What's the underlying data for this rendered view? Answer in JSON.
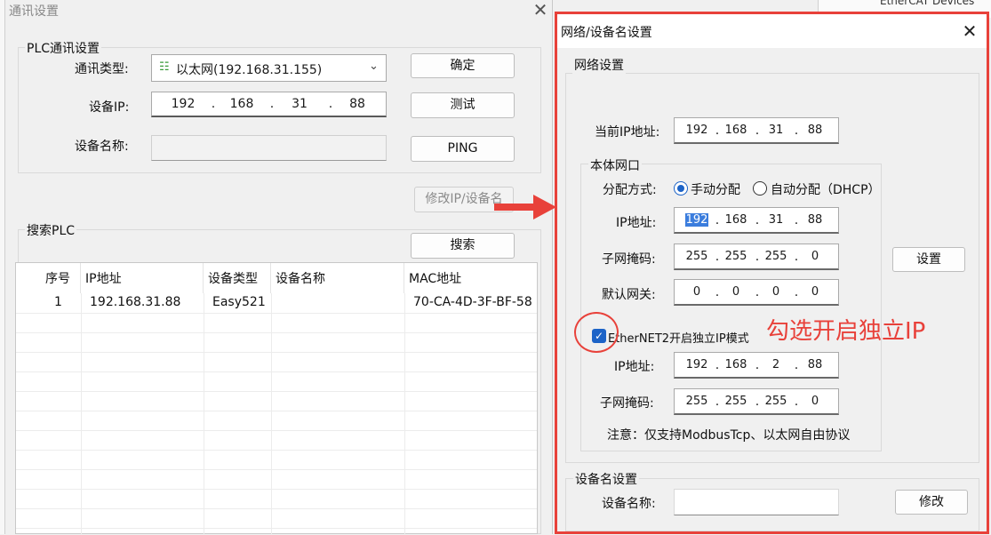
{
  "background": {
    "tree_item": "EtherCAT Devices"
  },
  "comm_dialog": {
    "title": "通讯设置",
    "plc_group_label": "PLC通讯设置",
    "comm_type_label": "通讯类型:",
    "comm_type_value": "以太网(192.168.31.155)",
    "device_ip_label": "设备IP:",
    "device_ip": [
      "192",
      "168",
      "31",
      "88"
    ],
    "device_name_label": "设备名称:",
    "confirm_button": "确定",
    "test_button": "测试",
    "ping_button": "PING",
    "modify_ip_button": "修改IP/设备名",
    "search_group_label": "搜索PLC",
    "search_button": "搜索",
    "table": {
      "columns": [
        "序号",
        "IP地址",
        "设备类型",
        "设备名称",
        "MAC地址"
      ],
      "rows": [
        {
          "no": "1",
          "ip": "192.168.31.88",
          "type": "Easy521",
          "name": "",
          "mac": "70-CA-4D-3F-BF-58"
        }
      ]
    }
  },
  "network_dialog": {
    "title": "网络/设备名设置",
    "network_group_label": "网络设置",
    "current_ip_label": "当前IP地址:",
    "current_ip": [
      "192",
      "168",
      "31",
      "88"
    ],
    "local_port_group_label": "本体网口",
    "alloc_label": "分配方式:",
    "alloc_manual": "手动分配",
    "alloc_auto": "自动分配（DHCP）",
    "ip_label": "IP地址:",
    "ip": [
      "192",
      "168",
      "31",
      "88"
    ],
    "subnet_label": "子网掩码:",
    "subnet": [
      "255",
      "255",
      "255",
      "0"
    ],
    "gateway_label": "默认网关:",
    "gateway": [
      "0",
      "0",
      "0",
      "0"
    ],
    "set_button": "设置",
    "ethernet2_checkbox": "EtherNET2开启独立IP模式",
    "eth2_ip_label": "IP地址:",
    "eth2_ip": [
      "192",
      "168",
      "2",
      "88"
    ],
    "eth2_subnet_label": "子网掩码:",
    "eth2_subnet": [
      "255",
      "255",
      "255",
      "0"
    ],
    "note": "注意：仅支持ModbusTcp、以太网自由协议",
    "device_name_group_label": "设备名设置",
    "device_name_label": "设备名称:",
    "device_name_value": "",
    "modify_button": "修改"
  },
  "annotation": {
    "text": "勾选开启独立IP",
    "color": "#e8413a"
  },
  "colors": {
    "accent": "#1c63c7",
    "annotation_red": "#e8413a"
  }
}
